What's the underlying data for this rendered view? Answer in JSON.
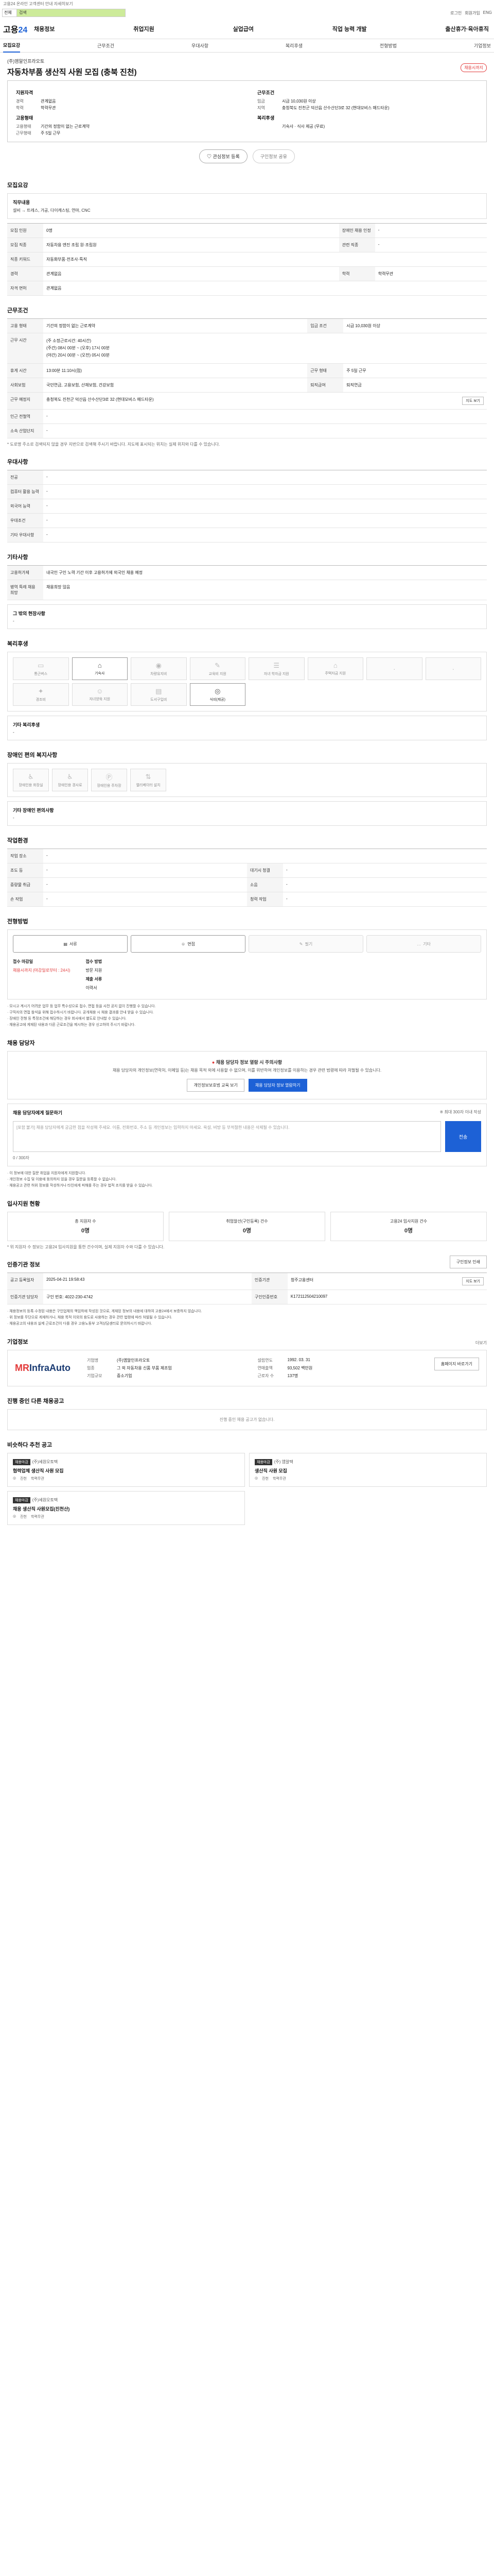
{
  "top_note": "고용24 온라인 고객센터 안내 자세히보기",
  "search": {
    "scope": "전체",
    "keyword": "검색"
  },
  "util": [
    "로그인",
    "회원가입",
    "ENG"
  ],
  "gnb": {
    "logo_main": "고용",
    "logo_num": "24",
    "items": [
      "채용정보",
      "취업지원",
      "실업급여",
      "직업 능력 개발",
      "출산휴가·육아휴직"
    ]
  },
  "tabs": [
    "모집요강",
    "근무조건",
    "우대사항",
    "복리후생",
    "전형방법",
    "기업정보"
  ],
  "job": {
    "company": "(주)엠알인프라오토",
    "title": "자동차부품 생산직 사원 모집 (충북 진천)",
    "status": "채용시까지"
  },
  "summary": {
    "left_head": "지원자격",
    "left_rows": [
      {
        "k": "경력",
        "v": "관계없음"
      },
      {
        "k": "학력",
        "v": "학력무관"
      }
    ],
    "left_head2": "고용형태",
    "left_rows2": [
      {
        "k": "고용형태",
        "v": "기간의 정함이 없는 근로계약"
      },
      {
        "k": "근무형태",
        "v": "주 5일 근무"
      }
    ],
    "right_head": "근무조건",
    "right_rows": [
      {
        "k": "임금",
        "v": "시급 10,030원 이상"
      },
      {
        "k": "지역",
        "v": "충청북도 진천군 덕산읍 산수산단3로 32 (현대모비스 매드타운)"
      }
    ],
    "right_head2": "복리후생",
    "right_rows2": [
      {
        "k": "",
        "v": "기숙사 · 식사 제공 (무료)"
      }
    ]
  },
  "actions": {
    "scrap": "관심정보 등록",
    "share": "구인정보 공유"
  },
  "recruit": {
    "section": "모집요강",
    "job_title_head": "직무내용",
    "job_desc": "설비 → 트레스, 가공, 다이캐스팅, 연마, CNC",
    "rows": [
      {
        "k1": "모집 인원",
        "v1": "0명",
        "k2": "장애인 채용 인정",
        "v2": "-"
      },
      {
        "k1": "모집 직종",
        "v1": "자동차용 엔진 조립 원·조립원",
        "k2": "관련 직종",
        "v2": "-"
      },
      {
        "k1": "직종 키워드",
        "v1": "자동화부품·전조사·특직",
        "k2": "",
        "v2": ""
      },
      {
        "k1": "경력",
        "v1": "관계없음",
        "k2": "학력",
        "v2": "학력무관"
      },
      {
        "k1": "자격 면허",
        "v1": "관계없음",
        "k2": "",
        "v2": ""
      }
    ]
  },
  "conditions": {
    "section": "근무조건",
    "rows": [
      {
        "k1": "고용 형태",
        "v1": "기간의 정함이 없는 근로계약",
        "k2": "임금 조건",
        "v2": "시급 10,030원 이상"
      },
      {
        "k1": "근무 시간",
        "v1": "(주 소정근로시간: 40시간)\n(주간) 08시 00분 ~ (오후) 17시 00분\n(야간) 20시 00분 ~ (오전) 05시 00분",
        "k2": "",
        "v2": ""
      },
      {
        "k1": "휴게 시간",
        "v1": "13:00분 11:10시(점)",
        "k2": "근무 형태",
        "v2": "주 5일 근무"
      },
      {
        "k1": "사회보험",
        "v1": "국민연금, 고용보험, 산재보험, 건강보험",
        "k2": "퇴직급여",
        "v2": "퇴직연금"
      },
      {
        "k1": "근무 예정지",
        "v1": "충청북도 진천군 덕산읍 산수산단3로 32 (현대모비스 매드타운)",
        "k2": "",
        "v2": ""
      },
      {
        "k1": "인근 전철역",
        "v1": "-",
        "k2": "",
        "v2": ""
      },
      {
        "k1": "소속 산업단지",
        "v1": "-",
        "k2": "",
        "v2": ""
      }
    ],
    "map_button": "지도 보기",
    "note": "* 도로명 주소로 검색되지 않을 경우 지번으로 검색해 주시기 바랍니다. 지도에 표시되는 위치는 실제 위치와 다를 수 있습니다."
  },
  "preference": {
    "section": "우대사항",
    "rows": [
      {
        "k": "전공",
        "v": "-"
      },
      {
        "k": "컴퓨터 활용 능력",
        "v": "-"
      },
      {
        "k": "외국어 능력",
        "v": "-"
      },
      {
        "k": "우대조건",
        "v": "-"
      },
      {
        "k": "기타 우대사항",
        "v": "-"
      }
    ]
  },
  "etc": {
    "section": "기타사항",
    "rows": [
      {
        "k": "고용허가제",
        "v": "내국인 구인 노력 기간 이후 고용허가제 외국인 채용 예정"
      },
      {
        "k": "병역 특례 채용 희망",
        "v": "채용희망 않음"
      }
    ],
    "other_head": "그 밖의 현장사항",
    "other_value": "-"
  },
  "welfare": {
    "section": "복리후생",
    "items": [
      {
        "label": "통근버스",
        "icon": "bus-icon",
        "on": false
      },
      {
        "label": "기숙사",
        "icon": "dormitory-icon",
        "on": true
      },
      {
        "label": "차량유지비",
        "icon": "car-icon",
        "on": false
      },
      {
        "label": "교육비 지원",
        "icon": "education-icon",
        "on": false
      },
      {
        "label": "자녀 학자금 지원",
        "icon": "tuition-icon",
        "on": false
      },
      {
        "label": "주택자금 지원",
        "icon": "house-icon",
        "on": false
      },
      {
        "label": "",
        "icon": "blank",
        "on": false
      },
      {
        "label": "",
        "icon": "blank",
        "on": false
      },
      {
        "label": "경조비",
        "icon": "gift-icon",
        "on": false
      },
      {
        "label": "자녀양육 지원",
        "icon": "child-icon",
        "on": false
      },
      {
        "label": "도서구입비",
        "icon": "book-icon",
        "on": false
      },
      {
        "label": "식비(제공)",
        "icon": "meal-icon",
        "on": true
      }
    ],
    "other_head": "기타 복리후생",
    "other_value": "-"
  },
  "disability": {
    "section": "장애인 편의 복지사항",
    "items": [
      {
        "label": "장애인용 화장실",
        "icon": "toilet-icon"
      },
      {
        "label": "장애인용 경사로",
        "icon": "ramp-icon"
      },
      {
        "label": "장애인용 주차장",
        "icon": "parking-icon"
      },
      {
        "label": "엘리베이터 설치",
        "icon": "elevator-icon"
      }
    ],
    "other_head": "기타 장애인 편의사항",
    "other_value": "-"
  },
  "environment": {
    "section": "작업환경",
    "rows": [
      {
        "k1": "작업 장소",
        "v1": "-",
        "k2": "",
        "v2": ""
      },
      {
        "k1": "조도 등",
        "v1": "-",
        "k2": "대기시 청결",
        "v2": "-"
      },
      {
        "k1": "중량물 취급",
        "v1": "-",
        "k2": "소음",
        "v2": "-"
      },
      {
        "k1": "손 작업",
        "v1": "-",
        "k2": "청력 작업",
        "v2": "-"
      }
    ]
  },
  "method": {
    "section": "전형방법",
    "items": [
      {
        "label": "서류",
        "icon": "document-icon",
        "on": true
      },
      {
        "label": "면접",
        "icon": "interview-icon",
        "on": true
      },
      {
        "label": "필기",
        "icon": "pencil-icon",
        "on": false
      },
      {
        "label": "기타",
        "icon": "etc-icon",
        "on": false
      }
    ]
  },
  "status": {
    "apply_period_head": "접수 마감일",
    "apply_period": "채용시까지 (마감일로부터 : 24시)",
    "apply_method_head": "접수 방법",
    "apply_method": "방문 지원",
    "documents_head": "제출 서류",
    "documents": "이력서",
    "bullets": [
      "· 모시고 계시기 어려운 업무 등 업무 특수성으로 접수, 면접 등을 사전 공지 없이 진행할 수 있습니다.",
      "· 구직자의 면접 참석을 위해 접수하시기 바랍니다. 공개채용 시 채용 결과를 안내 받을 수 있습니다.",
      "· 장애인 전형 등 특정조건에 해당하는 경우 회사에서 별도로 안내할 수 있습니다.",
      "· 채용공고에 게재된 내용과 다른 근로조건을 제시하는 경우 신고하여 주시기 바랍니다."
    ]
  },
  "manager": {
    "section": "채용 담당자",
    "warn_title": "채용 담당자 정보 열람 시 주의사항",
    "warn_text": "채용 담당자의 개인정보(연락처, 이메일 등)는 채용 목적 외에 사용할 수 없으며, 이를 위반하여 개인정보를 이용하는 경우 관련 법령에 따라 처벌될 수 있습니다.",
    "btn_info": "개인정보보호법 교육 보기",
    "btn_view": "채용 담당자 정보 열람하기",
    "msg_head": "채용 담당자에게 질문하기",
    "msg_limit": "※ 최대 300자 이내 작성",
    "msg_placeholder": "[포함 불가] 채용 담당자에게 궁금한 점을 작성해 주세요. 이름, 전화번호, 주소 등 개인정보는 입력하지 마세요. 욕설, 비방 등 부적절한 내용은 삭제될 수 있습니다.",
    "msg_count": "0 / 300자",
    "msg_send": "전송",
    "bullets": [
      "· 이 정보에 대한 질문 취업을 지원자에게 지원합니다.",
      "· 개인정보 수집 및 이용에 동의하지 않을 경우 질문을 등록할 수 없습니다.",
      "· 채용공고 관련 허위 정보를 작성하거나 타인에게 피해를 주는 경우 법적 조치를 받을 수 있습니다."
    ],
    "more_btn": "채용 담당자 정보"
  },
  "apply_status": {
    "section": "입사지원 현황",
    "cards": [
      {
        "label": "총 지원자 수",
        "n": "0명"
      },
      {
        "label": "취업알선(구인등록) 건수",
        "n": "0명"
      },
      {
        "label": "고용24 입사지원 건수",
        "n": "0명"
      }
    ],
    "note": "* 위 지원자 수 정보는 고용24 입사지원을 통한 건수이며, 실제 지원자 수와 다를 수 있습니다."
  },
  "notice_info": {
    "section": "인증기관 정보",
    "print_btn": "구인정보 인쇄",
    "rows": [
      {
        "k1": "공고 등록일자",
        "v1": "2025-04-21 19:58:43",
        "k2": "인증기관",
        "v2": "청주고용센터"
      },
      {
        "k1": "인증기관 담당자",
        "v1": "구인 번호: 4022-230-4742",
        "k2": "구인인증번호",
        "v2": "K172112504210097"
      }
    ],
    "map_btn": "지도 보기",
    "bullets": [
      "· 채용정보의 등록·수정된 내용은 구인업체의 책임하에 작성된 것으로, 게재된 정보의 내용에 대하여 고용24에서 보증하지 않습니다.",
      "· 위 정보를 무단으로 게재하거나, 채용 목적 이외의 용도로 사용하는 경우 관련 법령에 따라 처벌될 수 있습니다.",
      "· 채용공고의 내용과 실제 근로조건이 다를 경우 고용노동부 고객상담센터로 문의하시기 바랍니다."
    ]
  },
  "company": {
    "section": "기업정보",
    "more": "더보기",
    "logo_a": "MR",
    "logo_b": "InfraAuto",
    "rows": [
      {
        "k": "기업명",
        "v": "(주)엠알인프라오토"
      },
      {
        "k": "업종",
        "v": "그 외 자동차용 신품 부품 제조업"
      },
      {
        "k": "기업규모",
        "v": "중소기업"
      },
      {
        "k": "설립연도",
        "v": "1992. 03. 31"
      },
      {
        "k": "연매출액",
        "v": "93,502 백만원"
      },
      {
        "k": "근로자 수",
        "v": "137명"
      }
    ],
    "homepage_btn": "홈페이지 바로가기"
  },
  "other_jobs": {
    "section": "진행 중인 다른 채용공고",
    "empty": "진행 중인 채용 공고가 없습니다."
  },
  "similar": {
    "section": "비슷하다 추천 공고",
    "cards": [
      {
        "tag": "채용마감",
        "co": "(주)세원오토텍",
        "title": "협력업체 생산직 사원 모집",
        "meta1": "진천",
        "meta2": "학력무관"
      },
      {
        "tag": "채용마감",
        "co": "(주) 엠알텍",
        "title": "생산직 사원 모집",
        "meta1": "진천",
        "meta2": "학력무관"
      },
      {
        "tag": "채용마감",
        "co": "(주)세원오토텍",
        "title": "채용 생산직 사원모집(진천산)",
        "meta1": "진천",
        "meta2": "학력무관"
      }
    ]
  }
}
